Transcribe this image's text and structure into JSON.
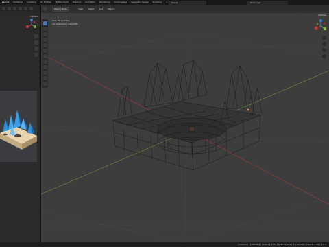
{
  "top_menu": {
    "items": [
      "Layout",
      "Modeling",
      "Sculpting",
      "UV Editing",
      "Texture Paint",
      "Shading",
      "Animation",
      "Rendering",
      "Compositing",
      "Geometry Nodes",
      "Scripting",
      "+"
    ],
    "active_index": 0,
    "scene": "Scene",
    "view_layer": "ViewLayer"
  },
  "left_editor": {
    "options_label": "Options"
  },
  "viewport": {
    "mode": "Object Mode",
    "menu": [
      "View",
      "Select",
      "Add",
      "Object"
    ],
    "options_label": "Options",
    "overlay_line1": "User Perspective",
    "overlay_line2": "(1) Collection | Cube.005"
  },
  "toolbar": {
    "tools": [
      "select-box-tool",
      "cursor-tool",
      "move-tool",
      "rotate-tool",
      "scale-tool",
      "transform-tool",
      "annotate-tool",
      "measure-tool",
      "add-cube-tool",
      "extrude-tool",
      "edit-tool",
      "loop-cut-tool"
    ]
  },
  "status": {
    "left": "",
    "right": "Collection | Cube.005 | Verts 11,278 | Faces 11,104 | Tris 22,208 | Objects 1/30 | 3.6.1"
  },
  "colors": {
    "x_axis": "#c8383e",
    "y_axis": "#7fb03c",
    "z_axis": "#3d78c9",
    "active_tool": "#4772b3"
  }
}
